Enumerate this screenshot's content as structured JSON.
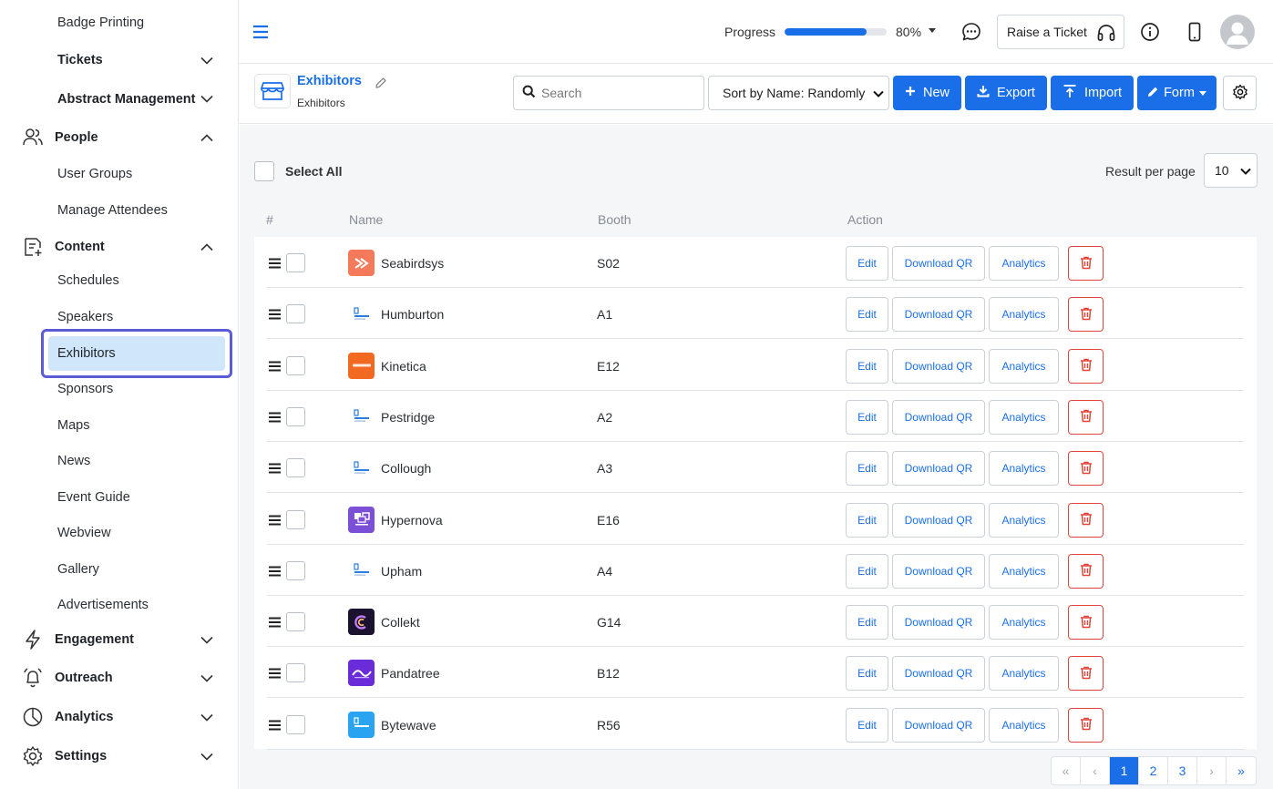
{
  "sidebar": {
    "badge_printing": "Badge Printing",
    "tickets": "Tickets",
    "abstract_management": "Abstract Management",
    "people": "People",
    "user_groups": "User Groups",
    "manage_attendees": "Manage Attendees",
    "content": "Content",
    "schedules": "Schedules",
    "speakers": "Speakers",
    "exhibitors": "Exhibitors",
    "sponsors": "Sponsors",
    "maps": "Maps",
    "news": "News",
    "event_guide": "Event Guide",
    "webview": "Webview",
    "gallery": "Gallery",
    "advertisements": "Advertisements",
    "engagement": "Engagement",
    "outreach": "Outreach",
    "analytics": "Analytics",
    "settings": "Settings"
  },
  "topbar": {
    "progress_label": "Progress",
    "progress_value": 0.8,
    "progress_text": "80%",
    "raise_ticket": "Raise a Ticket"
  },
  "page": {
    "title": "Exhibitors",
    "breadcrumb": "Exhibitors",
    "search_placeholder": "Search",
    "sort_label": "Sort by Name: Randomly",
    "new_label": "New",
    "export_label": "Export",
    "import_label": "Import",
    "form_label": "Form"
  },
  "list": {
    "select_all": "Select All",
    "result_per_page": "Result per page",
    "per_page_value": "10",
    "col_num": "#",
    "col_name": "Name",
    "col_booth": "Booth",
    "col_action": "Action",
    "edit_label": "Edit",
    "qr_label": "Download QR",
    "analytics_label": "Analytics",
    "rows": [
      {
        "name": "Seabirdsys",
        "booth": "S02",
        "logo_color": "#f47a5b",
        "logo_style": "arrow"
      },
      {
        "name": "Humburton",
        "booth": "A1",
        "logo_color": "#ffffff",
        "logo_style": "mini"
      },
      {
        "name": "Kinetica",
        "booth": "E12",
        "logo_color": "#f26a21",
        "logo_style": "word"
      },
      {
        "name": "Pestridge",
        "booth": "A2",
        "logo_color": "#ffffff",
        "logo_style": "mini"
      },
      {
        "name": "Collough",
        "booth": "A3",
        "logo_color": "#ffffff",
        "logo_style": "mini"
      },
      {
        "name": "Hypernova",
        "booth": "E16",
        "logo_color": "#7b4fd6",
        "logo_style": "block"
      },
      {
        "name": "Upham",
        "booth": "A4",
        "logo_color": "#ffffff",
        "logo_style": "mini"
      },
      {
        "name": "Collekt",
        "booth": "G14",
        "logo_color": "#1b1230",
        "logo_style": "ring"
      },
      {
        "name": "Pandatree",
        "booth": "B12",
        "logo_color": "#6a2bd8",
        "logo_style": "wave"
      },
      {
        "name": "Bytewave",
        "booth": "R56",
        "logo_color": "#2aa3f0",
        "logo_style": "mini-blue"
      }
    ]
  },
  "pagination": {
    "first": "«",
    "prev": "‹",
    "p1": "1",
    "p2": "2",
    "p3": "3",
    "next": "›",
    "last": "»"
  }
}
